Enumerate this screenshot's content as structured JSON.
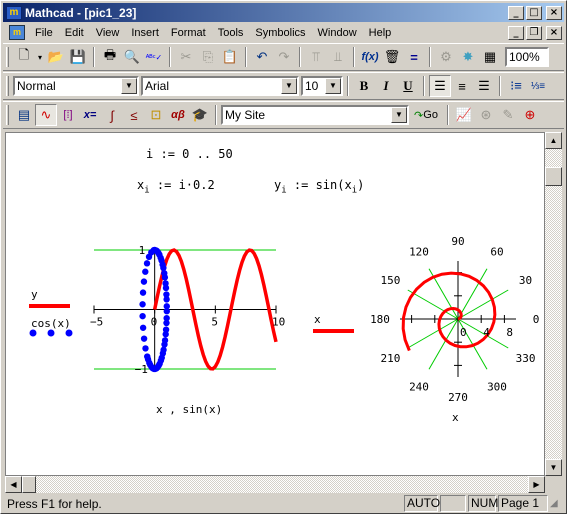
{
  "window": {
    "title": "Mathcad - [pic1_23]",
    "icon": "mathcad-app-icon"
  },
  "menubar": {
    "items": [
      {
        "label": "File",
        "accel": "F"
      },
      {
        "label": "Edit",
        "accel": "E"
      },
      {
        "label": "View",
        "accel": "V"
      },
      {
        "label": "Insert",
        "accel": "I"
      },
      {
        "label": "Format",
        "accel": "o"
      },
      {
        "label": "Tools",
        "accel": "T"
      },
      {
        "label": "Symbolics",
        "accel": "S"
      },
      {
        "label": "Window",
        "accel": "W"
      },
      {
        "label": "Help",
        "accel": "H"
      }
    ]
  },
  "standard_toolbar": {
    "buttons": [
      "new-icon",
      "open-icon",
      "save-icon",
      "print-icon",
      "print-preview-icon",
      "spell-check-icon",
      "cut-icon",
      "copy-icon",
      "paste-icon",
      "undo-icon",
      "redo-icon",
      "align-across-icon",
      "align-down-icon",
      "insert-function-icon",
      "insert-unit-icon",
      "calculate-icon",
      "insert-component-icon",
      "resource-center-icon",
      "insert-table-icon"
    ],
    "zoom": "100%"
  },
  "format_toolbar": {
    "style": "Normal",
    "font": "Arial",
    "size": "10",
    "bold": "B",
    "italic": "I",
    "underline": "U"
  },
  "math_toolbar": {
    "buttons": [
      "calculator-icon",
      "graph-icon",
      "matrix-icon",
      "evaluation-icon",
      "calculus-icon",
      "boolean-icon",
      "programming-icon",
      "greek-icon",
      "symbolic-icon"
    ],
    "url": "My Site",
    "go_label": "Go"
  },
  "worksheet": {
    "range_def": {
      "lhs": "i",
      "op": ":=",
      "rhs": "0 .. 50"
    },
    "x_def": {
      "lhs": "x",
      "sub": "i",
      "op": ":=",
      "rhs": "i·0.2"
    },
    "y_def": {
      "lhs": "y",
      "sub": "i",
      "op": ":=",
      "rhs_fn": "sin",
      "rhs_arg": "x",
      "rhs_sub": "i"
    }
  },
  "chart_data": [
    {
      "type": "line",
      "title": "",
      "xlabel": "x , sin(x)",
      "ylabel": "",
      "xlim": [
        -5,
        10
      ],
      "ylim": [
        -1,
        1
      ],
      "x_ticks": [
        "-5",
        "0",
        "5",
        "10"
      ],
      "y_ticks": [
        "1",
        "-1"
      ],
      "grid": "horizontal-only",
      "legend": [
        {
          "label": "y",
          "style": "solid",
          "color": "#ff0000"
        },
        {
          "label": "cos(x)",
          "style": "dots",
          "color": "#0000ff"
        }
      ],
      "series": [
        {
          "name": "y",
          "x_expr": "x_i = i*0.2, i=0..50",
          "y_expr": "sin(x_i)",
          "x_range": [
            0,
            10
          ],
          "color": "#ff0000"
        },
        {
          "name": "cos(x)",
          "x_expr": "sin(x_i)",
          "y_expr": "cos(x_i)",
          "x_range": [
            -1,
            1
          ],
          "color": "#0000ff"
        }
      ]
    },
    {
      "type": "polar",
      "title": "",
      "xlabel": "x",
      "angle_ticks": [
        "0",
        "30",
        "60",
        "90",
        "120",
        "150",
        "180",
        "210",
        "240",
        "270",
        "300",
        "330"
      ],
      "radial_ticks": [
        "0",
        "4",
        "8"
      ],
      "rlim": [
        0,
        10
      ],
      "legend": [
        {
          "label": "x",
          "style": "solid",
          "color": "#ff0000"
        }
      ],
      "series": [
        {
          "name": "x",
          "theta_expr": "x_i (radians)",
          "r_expr": "x_i",
          "theta_range": [
            0,
            10
          ],
          "color": "#ff0000"
        }
      ]
    }
  ],
  "statusbar": {
    "help_text": "Press F1 for help.",
    "mode": "AUTO",
    "blank": "",
    "num": "NUM",
    "page": "Page 1"
  }
}
